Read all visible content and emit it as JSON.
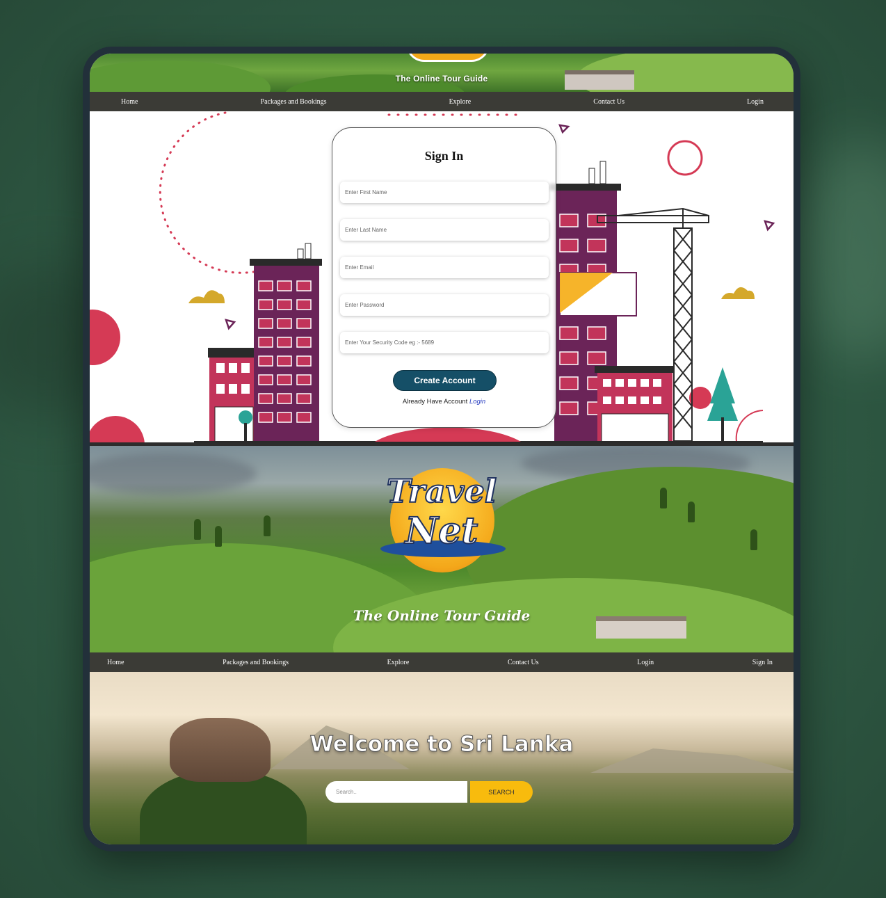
{
  "top_banner": {
    "tagline": "The Online Tour Guide"
  },
  "nav_top": {
    "items": [
      "Home",
      "Packages and Bookings",
      "Explore",
      "Contact Us",
      "Login"
    ]
  },
  "signin": {
    "title": "Sign In",
    "fields": [
      {
        "placeholder": "Enter First Name"
      },
      {
        "placeholder": "Enter Last Name"
      },
      {
        "placeholder": "Enter Email"
      },
      {
        "placeholder": "Enter Password"
      },
      {
        "placeholder": "Enter Your Security Code eg :- 5689"
      }
    ],
    "create_button": "Create Account",
    "already_text": "Already Have Account",
    "login_link": "Login"
  },
  "hero": {
    "logo_word1": "Travel",
    "logo_word2": "Net",
    "tagline": "The Online Tour Guide"
  },
  "nav_bottom": {
    "items": [
      "Home",
      "Packages and Bookings",
      "Explore",
      "Contact Us",
      "Login",
      "Sign In"
    ]
  },
  "welcome": {
    "title": "Welcome to Sri Lanka",
    "search_placeholder": "Search..",
    "search_button": "SEARCH"
  },
  "colors": {
    "nav_bg": "#3b3b36",
    "create_button": "#154f67",
    "search_button": "#f8bb0d",
    "building_magenta": "#c2345a",
    "building_purple": "#6b2458",
    "accent_red": "#d53a55"
  }
}
